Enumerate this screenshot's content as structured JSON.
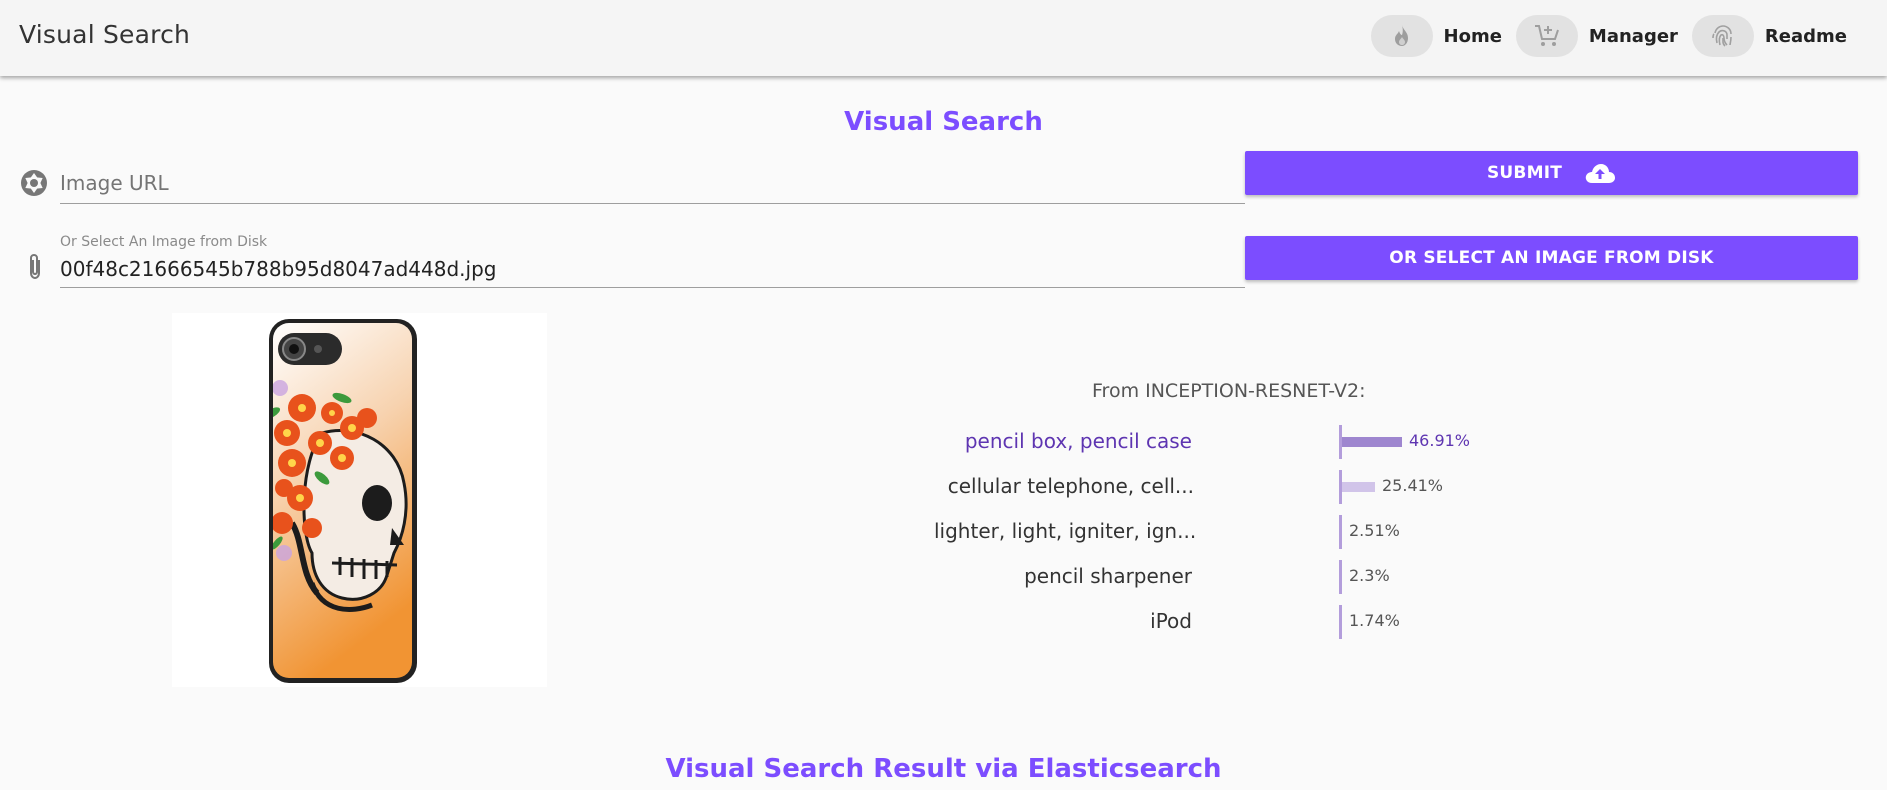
{
  "app": {
    "title": "Visual Search",
    "nav": [
      {
        "label": "Home",
        "icon": "fire-icon"
      },
      {
        "label": "Manager",
        "icon": "cart-add-icon"
      },
      {
        "label": "Readme",
        "icon": "fingerprint-icon"
      }
    ]
  },
  "main": {
    "heading": "Visual Search",
    "url_input": {
      "placeholder": "Image URL",
      "value": ""
    },
    "submit_label": "SUBMIT",
    "file_input": {
      "label": "Or Select An Image from Disk",
      "value": "00f48c21666545b788b95d8047ad448d.jpg"
    },
    "select_disk_label": "OR SELECT AN IMAGE FROM DISK",
    "preview_image": "phone case with flowered skull (uploaded image)",
    "predictions": {
      "title": "From INCEPTION-RESNET-V2:",
      "items": [
        {
          "label": "pencil box, pencil case",
          "pct": "46.91%",
          "value": 46.91
        },
        {
          "label": "cellular telephone, cell...",
          "pct": "25.41%",
          "value": 25.41
        },
        {
          "label": "lighter, light, igniter, ign...",
          "pct": "2.51%",
          "value": 2.51
        },
        {
          "label": "pencil sharpener",
          "pct": "2.3%",
          "value": 2.3
        },
        {
          "label": "iPod",
          "pct": "1.74%",
          "value": 1.74
        }
      ]
    },
    "results_heading": "Visual Search Result via Elasticsearch"
  },
  "colors": {
    "accent": "#7c4dff",
    "bar": "#b39ddb"
  }
}
